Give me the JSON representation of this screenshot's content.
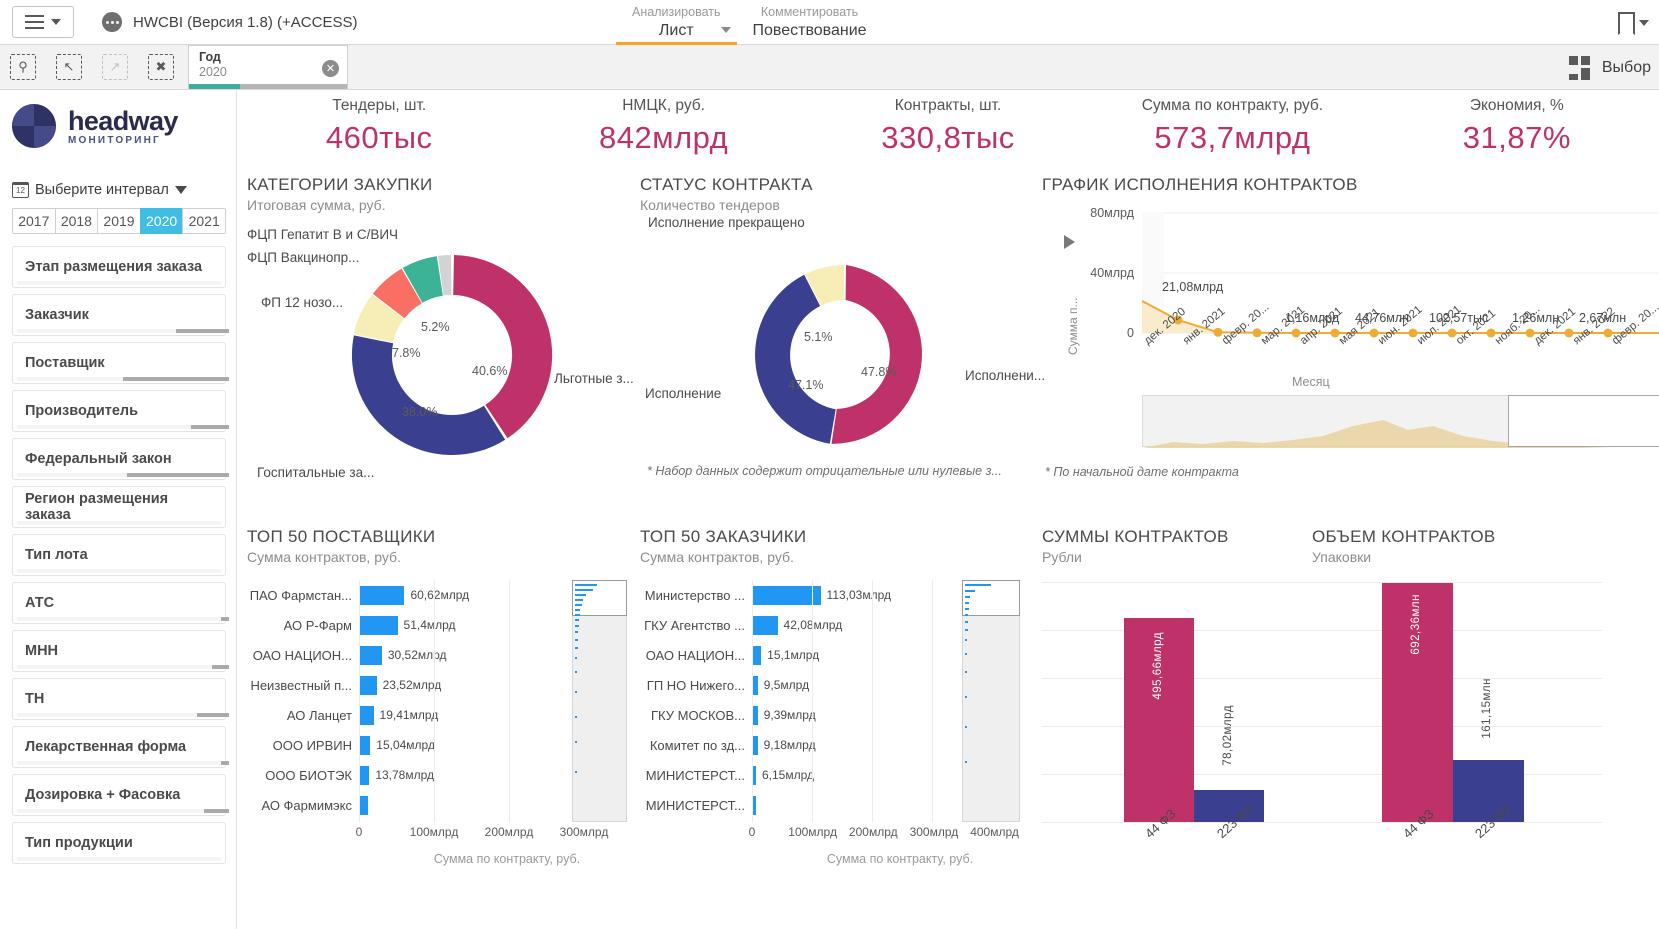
{
  "topbar": {
    "app_title": "HWCBI (Версия 1.8) (+ACCESS)",
    "menu_icon": "hamburger-icon",
    "tabs": [
      {
        "top": "Анализировать",
        "bottom": "Лист",
        "active": true,
        "has_chevron": true
      },
      {
        "top": "Комментировать",
        "bottom": "Повествование",
        "active": false,
        "has_chevron": false
      }
    ],
    "bookmark_icon": "bookmark-icon"
  },
  "toolbar": {
    "icons": [
      "selection-search-icon",
      "step-back-icon",
      "step-forward-icon",
      "clear-selections-icon"
    ],
    "selection_chip": {
      "field": "Год",
      "value": "2020",
      "clear_icon": "clear-icon"
    },
    "right_label": "Выбор",
    "right_icon": "sheet-grid-icon"
  },
  "sidebar": {
    "brand": {
      "name": "headway",
      "tagline": "МОНИТОРИНГ"
    },
    "interval": {
      "icon": "calendar-icon",
      "label": "Выберите интервал",
      "chevron": "chevron-down-icon"
    },
    "years": [
      {
        "label": "2017",
        "selected": false
      },
      {
        "label": "2018",
        "selected": false
      },
      {
        "label": "2019",
        "selected": false
      },
      {
        "label": "2020",
        "selected": true
      },
      {
        "label": "2021",
        "selected": false
      }
    ],
    "filters": [
      {
        "label": "Этап размещения заказа",
        "thumb_left": 0,
        "thumb_width": 0
      },
      {
        "label": "Заказчик",
        "thumb_left": 75,
        "thumb_width": 25
      },
      {
        "label": "Поставщик",
        "thumb_left": 50,
        "thumb_width": 50
      },
      {
        "label": "Производитель",
        "thumb_left": 82,
        "thumb_width": 18
      },
      {
        "label": "Федеральный закон",
        "thumb_left": 52,
        "thumb_width": 48
      },
      {
        "label": "Регион размещения заказа",
        "thumb_left": 0,
        "thumb_width": 0
      },
      {
        "label": "Тип лота",
        "thumb_left": 0,
        "thumb_width": 0
      },
      {
        "label": "АТС",
        "thumb_left": 96,
        "thumb_width": 4
      },
      {
        "label": "МНН",
        "thumb_left": 92,
        "thumb_width": 8
      },
      {
        "label": "ТН",
        "thumb_left": 85,
        "thumb_width": 15
      },
      {
        "label": "Лекарственная форма",
        "thumb_left": 96,
        "thumb_width": 4
      },
      {
        "label": "Дозировка + Фасовка",
        "thumb_left": 88,
        "thumb_width": 12
      },
      {
        "label": "Тип продукции",
        "thumb_left": 0,
        "thumb_width": 0
      }
    ]
  },
  "kpis": [
    {
      "label": "Тендеры, шт.",
      "value": "460тыс"
    },
    {
      "label": "НМЦК, руб.",
      "value": "842млрд"
    },
    {
      "label": "Контракты, шт.",
      "value": "330,8тыс"
    },
    {
      "label": "Сумма по контракту, руб.",
      "value": "573,7млрд"
    },
    {
      "label": "Экономия, %",
      "value": "31,87%"
    }
  ],
  "accent_colors": {
    "magenta": "#bf3269",
    "navy": "#3b3f8f",
    "cream": "#f7eeb7",
    "salmon": "#fa6f63",
    "teal": "#3cb296",
    "grey": "#d3d3d3",
    "blue": "#2196f3",
    "orange": "#eeab36",
    "tab_underline": "#f6a623",
    "year_selected": "#3fbde2"
  },
  "chart_data": [
    {
      "id": "categories-donut",
      "type": "pie",
      "title": "КАТЕГОРИИ ЗАКУПКИ",
      "subtitle": "Итоговая сумма, руб.",
      "labels": [
        "Льготные з...",
        "Госпитальные за...",
        "ФП 12 нозо...",
        "ФЦП Вакцинопр...",
        "ФЦП Гепатит В и С/ВИЧ"
      ],
      "values": [
        40.6,
        38.0,
        7.8,
        5.2,
        1.2
      ],
      "value_labels": [
        "40.6%",
        "38.0%",
        "7.8%",
        "5.2%",
        ""
      ],
      "colors": [
        "#bf3269",
        "#3b3f8f",
        "#f7eeb7",
        "#fa6f63",
        "#3cb296"
      ],
      "extra_slice_color": "#d3d3d3"
    },
    {
      "id": "contract-status-donut",
      "type": "pie",
      "title": "СТАТУС КОНТРАКТА",
      "subtitle": "Количество тендеров",
      "labels": [
        "Исполнени...",
        "Исполнение",
        "Исполнение прекращено"
      ],
      "values": [
        47.8,
        47.1,
        5.1
      ],
      "value_labels": [
        "47.8%",
        "47.1%",
        "5.1%"
      ],
      "colors": [
        "#bf3269",
        "#3b3f8f",
        "#f7eeb7"
      ],
      "note": "* Набор данных содержит отрицательные или нулевые з..."
    },
    {
      "id": "execution-line",
      "type": "area",
      "title": "ГРАФИК ИСПОЛНЕНИЯ КОНТРАКТОВ",
      "ylabel": "Сумма п...",
      "xlabel": "Месяц",
      "yticks": [
        "0",
        "40млрд",
        "80млрд"
      ],
      "ylim": [
        0,
        80
      ],
      "x": [
        "дек. 2020",
        "янв. 2021",
        "февр. 20...",
        "мар. 2021",
        "апр. 2021",
        "мая 2021",
        "июн. 2021",
        "июл. 2021",
        "окт. 2021",
        "нояб. 20...",
        "дек. 2021",
        "янв. 2022",
        "февр. 20..."
      ],
      "values": [
        21.08,
        8.5,
        1.16,
        0.5,
        0.3,
        0.25,
        0.2,
        0.15,
        0.12,
        0.1,
        0.1,
        0.1,
        0.1
      ],
      "point_labels": [
        "21,08млрд",
        "",
        "1,16млрд",
        "44,76млн",
        "102,57тыс",
        "1,26млн",
        "2,67млн",
        "",
        "",
        "",
        "",
        "",
        ""
      ],
      "series_color": "#eeab36",
      "note": "* По начальной дате контракта"
    },
    {
      "id": "top50-suppliers",
      "type": "bar",
      "orientation": "horizontal",
      "title": "ТОП 50 ПОСТАВЩИКИ",
      "subtitle": "Сумма контрактов, руб.",
      "categories": [
        "ПАО Фармстан...",
        "АО Р-Фарм",
        "ОАО НАЦИОН...",
        "Неизвестный п...",
        "АО Ланцет",
        "ООО ИРВИН",
        "ООО БИОТЭК",
        "АО Фармимэкс"
      ],
      "values": [
        60.62,
        51.4,
        30.52,
        23.52,
        19.41,
        15.04,
        13.78,
        12.2
      ],
      "value_labels": [
        "60,62млрд",
        "51,4млрд",
        "30,52млрд",
        "23,52млрд",
        "19,41млрд",
        "15,04млрд",
        "13,78млрд",
        ""
      ],
      "xticks": [
        "0",
        "100млрд",
        "200млрд",
        "300млрд"
      ],
      "xlim": [
        0,
        380
      ],
      "xlabel": "Сумма по контракту, руб.",
      "bar_color": "#2196f3"
    },
    {
      "id": "top50-customers",
      "type": "bar",
      "orientation": "horizontal",
      "title": "ТОП 50 ЗАКАЗЧИКИ",
      "subtitle": "Сумма контрактов, руб.",
      "categories": [
        "Министерство ...",
        "ГКУ Агентство ...",
        "ОАО НАЦИОН...",
        "ГП НО Нижего...",
        "ГКУ МОСКОВ...",
        "Комитет по зд...",
        "МИНИСТЕРСТ...",
        "МИНИСТЕРСТ..."
      ],
      "values": [
        113.03,
        42.08,
        15.1,
        9.5,
        9.39,
        9.18,
        6.15,
        5.2
      ],
      "value_labels": [
        "113,03млрд",
        "42,08млрд",
        "15,1млрд",
        "9,5млрд",
        "9,39млрд",
        "9,18млрд",
        "6,15млрд",
        ""
      ],
      "xticks": [
        "0",
        "100млрд",
        "200млрд",
        "300млрд",
        "400млрд"
      ],
      "xlim": [
        0,
        470
      ],
      "xlabel": "Сумма по контракту, руб.",
      "bar_color": "#2196f3"
    },
    {
      "id": "contract-sums",
      "type": "bar",
      "orientation": "vertical",
      "title": "СУММЫ КОНТРАКТОВ",
      "subtitle": "Рубли",
      "categories": [
        "44 ФЗ",
        "223 ФЗ"
      ],
      "values": [
        495.66,
        78.02
      ],
      "value_labels": [
        "495,66млрд",
        "78,02млрд"
      ],
      "colors": [
        "#bf3269",
        "#3b3f8f"
      ],
      "ylim": [
        0,
        600
      ]
    },
    {
      "id": "contract-volume",
      "type": "bar",
      "orientation": "vertical",
      "title": "ОБЪЕМ КОНТРАКТОВ",
      "subtitle": "Упаковки",
      "categories": [
        "44 ФЗ",
        "223 ФЗ"
      ],
      "values": [
        692.36,
        161.15
      ],
      "value_labels": [
        "692,36млн",
        "161,15млн"
      ],
      "colors": [
        "#bf3269",
        "#3b3f8f"
      ],
      "ylim": [
        0,
        780
      ]
    }
  ]
}
